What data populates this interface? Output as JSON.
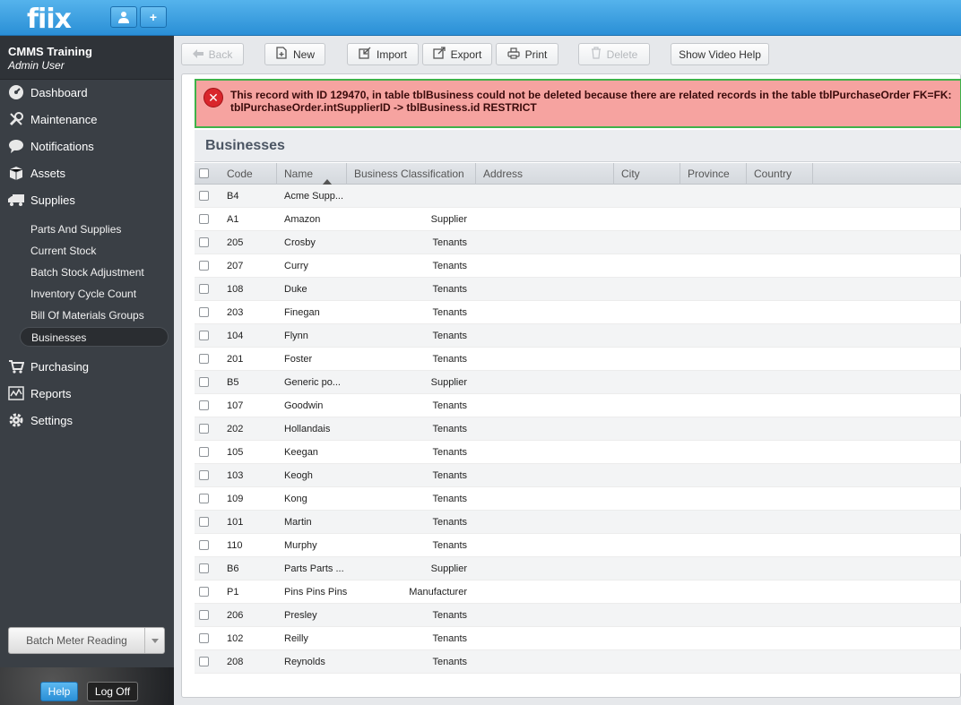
{
  "app": {
    "logo": "fiix",
    "org_name": "CMMS Training",
    "user_role": "Admin User"
  },
  "nav": {
    "items": [
      {
        "label": "Dashboard",
        "icon": "dashboard-icon"
      },
      {
        "label": "Maintenance",
        "icon": "wrench-icon"
      },
      {
        "label": "Notifications",
        "icon": "speech-bubble-icon"
      },
      {
        "label": "Assets",
        "icon": "box-icon"
      },
      {
        "label": "Supplies",
        "icon": "truck-icon"
      },
      {
        "label": "Purchasing",
        "icon": "cart-icon"
      },
      {
        "label": "Reports",
        "icon": "chart-icon"
      },
      {
        "label": "Settings",
        "icon": "gear-icon"
      }
    ],
    "supplies_sub": [
      "Parts And Supplies",
      "Current Stock",
      "Batch Stock Adjustment",
      "Inventory Cycle Count",
      "Bill Of Materials Groups",
      "Businesses"
    ],
    "active_sub": "Businesses"
  },
  "sidebar_bottom": {
    "batch_label": "Batch Meter Reading",
    "help_label": "Help",
    "logoff_label": "Log Off"
  },
  "toolbar": {
    "back": "Back",
    "new": "New",
    "import": "Import",
    "export": "Export",
    "print": "Print",
    "delete": "Delete",
    "video_help": "Show Video Help"
  },
  "error_message": "This record with ID 129470, in table tblBusiness could not be deleted because there are related records in the table tblPurchaseOrder FK=FK: tblPurchaseOrder.intSupplierID -> tblBusiness.id RESTRICT",
  "section_title": "Businesses",
  "table": {
    "columns": [
      "Code",
      "Name",
      "Business Classification",
      "Address",
      "City",
      "Province",
      "Country"
    ],
    "rows": [
      {
        "code": "B4",
        "name": "Acme Supp...",
        "classification": ""
      },
      {
        "code": "A1",
        "name": "Amazon",
        "classification": "Supplier"
      },
      {
        "code": "205",
        "name": "Crosby",
        "classification": "Tenants"
      },
      {
        "code": "207",
        "name": "Curry",
        "classification": "Tenants"
      },
      {
        "code": "108",
        "name": "Duke",
        "classification": "Tenants"
      },
      {
        "code": "203",
        "name": "Finegan",
        "classification": "Tenants"
      },
      {
        "code": "104",
        "name": "Flynn",
        "classification": "Tenants"
      },
      {
        "code": "201",
        "name": "Foster",
        "classification": "Tenants"
      },
      {
        "code": "B5",
        "name": "Generic po...",
        "classification": "Supplier"
      },
      {
        "code": "107",
        "name": "Goodwin",
        "classification": "Tenants"
      },
      {
        "code": "202",
        "name": "Hollandais",
        "classification": "Tenants"
      },
      {
        "code": "105",
        "name": "Keegan",
        "classification": "Tenants"
      },
      {
        "code": "103",
        "name": "Keogh",
        "classification": "Tenants"
      },
      {
        "code": "109",
        "name": "Kong",
        "classification": "Tenants"
      },
      {
        "code": "101",
        "name": "Martin",
        "classification": "Tenants"
      },
      {
        "code": "110",
        "name": "Murphy",
        "classification": "Tenants"
      },
      {
        "code": "B6",
        "name": "Parts Parts ...",
        "classification": "Supplier"
      },
      {
        "code": "P1",
        "name": "Pins Pins Pins",
        "classification": "Manufacturer"
      },
      {
        "code": "206",
        "name": "Presley",
        "classification": "Tenants"
      },
      {
        "code": "102",
        "name": "Reilly",
        "classification": "Tenants"
      },
      {
        "code": "208",
        "name": "Reynolds",
        "classification": "Tenants"
      }
    ]
  },
  "colors": {
    "topbar": "#2a8fd6",
    "sidebar": "#3a3f45",
    "error_bg": "#f6a3a0",
    "error_border": "#3fb24a"
  }
}
